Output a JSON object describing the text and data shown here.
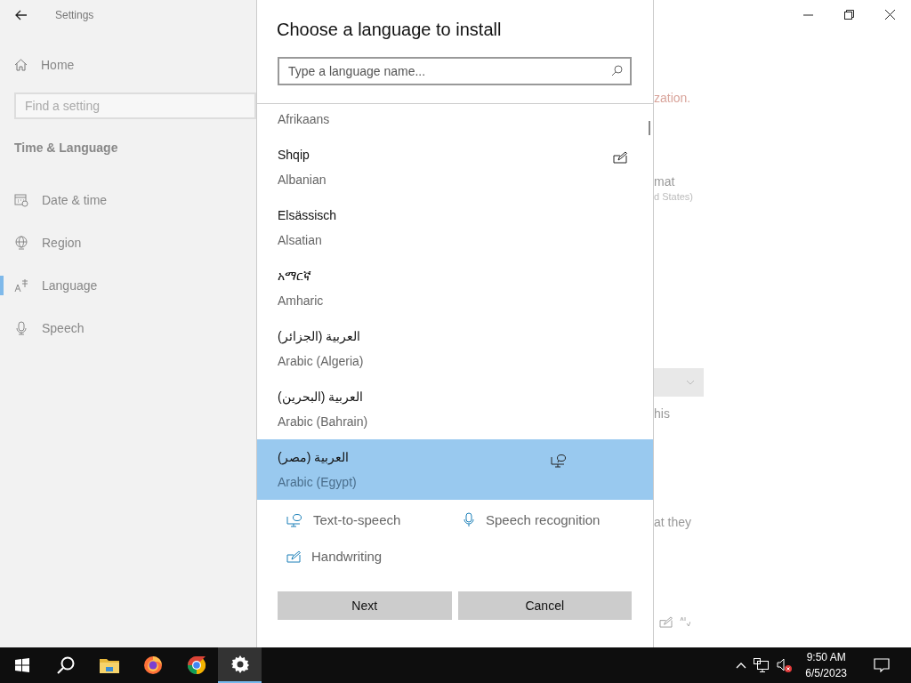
{
  "settings": {
    "title": "Settings",
    "home": "Home",
    "search": {
      "placeholder": "Find a setting"
    },
    "section": "Time & Language",
    "nav": [
      {
        "label": "Date & time",
        "kind": "calendar",
        "selected": false
      },
      {
        "label": "Region",
        "kind": "globe",
        "selected": false
      },
      {
        "label": "Language",
        "kind": "language",
        "selected": true
      },
      {
        "label": "Speech",
        "kind": "microphone",
        "selected": false
      }
    ],
    "fragments": [
      {
        "kind": "warning",
        "text": "zation."
      },
      {
        "kind": "label",
        "text": "mat"
      },
      {
        "kind": "caption",
        "text": "d States)"
      },
      {
        "kind": "dropdown"
      },
      {
        "kind": "label",
        "text": "his"
      },
      {
        "kind": "label",
        "text": "at they"
      },
      {
        "kind": "feature-icons"
      }
    ]
  },
  "dialog": {
    "title": "Choose a language to install",
    "search": {
      "placeholder": "Type a language name..."
    },
    "languages": [
      {
        "english": "Afrikaans",
        "handwriting": false,
        "tts": false,
        "selected": false
      },
      {
        "native": "Shqip",
        "english": "Albanian",
        "handwriting": true,
        "tts": false,
        "selected": false
      },
      {
        "native": "Elsässisch",
        "english": "Alsatian",
        "handwriting": false,
        "tts": false,
        "selected": false
      },
      {
        "native": "አማርኛ",
        "english": "Amharic",
        "handwriting": false,
        "tts": false,
        "selected": false
      },
      {
        "native": "العربية (الجزائر)",
        "english": "Arabic (Algeria)",
        "handwriting": false,
        "tts": false,
        "selected": false
      },
      {
        "native": "العربية (البحرين)",
        "english": "Arabic (Bahrain)",
        "handwriting": false,
        "tts": false,
        "selected": false
      },
      {
        "native": "العربية (مصر)",
        "english": "Arabic (Egypt)",
        "handwriting": false,
        "tts": true,
        "selected": true
      }
    ],
    "legend": [
      {
        "kind": "tts",
        "label": "Text-to-speech"
      },
      {
        "kind": "speech",
        "label": "Speech recognition"
      },
      {
        "kind": "handwriting",
        "label": "Handwriting"
      }
    ],
    "buttons": [
      "Next",
      "Cancel"
    ]
  },
  "taskbar": {
    "apps": [
      {
        "kind": "start",
        "active": false
      },
      {
        "kind": "search",
        "active": false
      },
      {
        "kind": "explorer",
        "active": false
      },
      {
        "kind": "firefox",
        "active": false
      },
      {
        "kind": "chrome",
        "active": false
      },
      {
        "kind": "settings",
        "active": true
      }
    ],
    "clock": {
      "time": "9:50 AM",
      "date": "6/5/2023"
    }
  }
}
